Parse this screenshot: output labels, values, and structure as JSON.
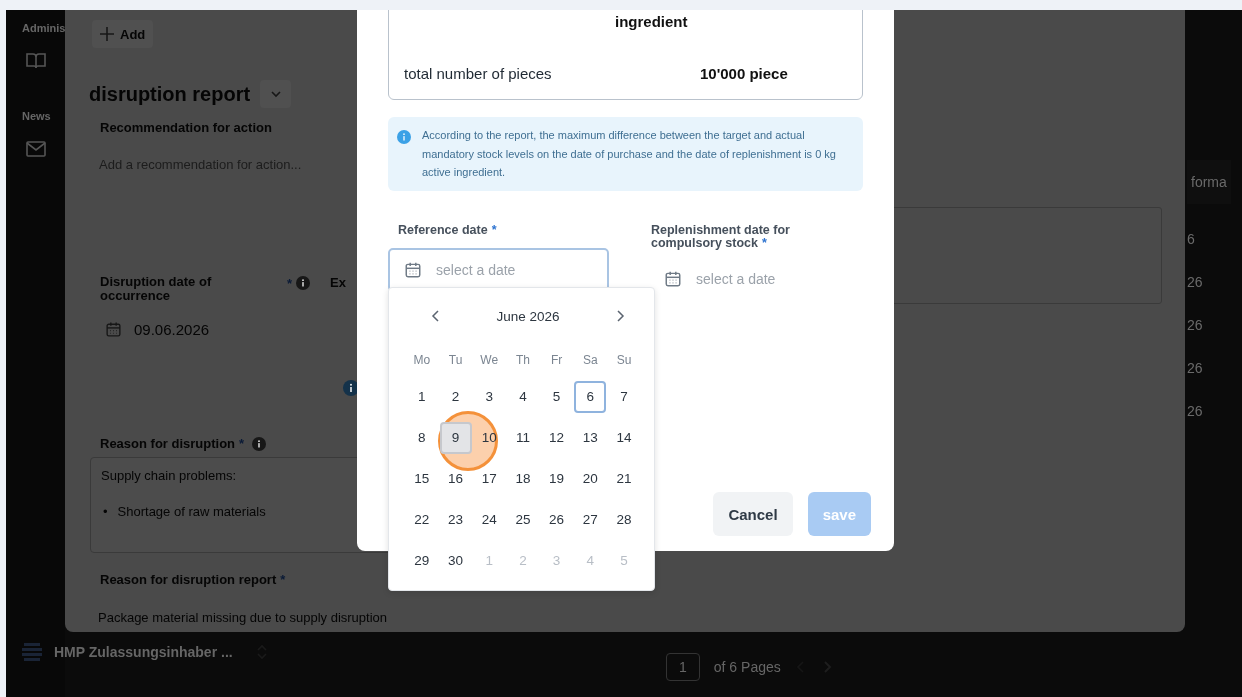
{
  "sidebar": {
    "section_title": "Adminis",
    "news_title": "News"
  },
  "account": {
    "name": "HMP Zulassungsinhaber ..."
  },
  "pager": {
    "page": "1",
    "of_pages": "of 6 Pages"
  },
  "drawer": {
    "add_button": "Add",
    "title": "disruption report",
    "recommendation": {
      "label": "Recommendation for action",
      "placeholder": "Add a recommendation for action..."
    },
    "occurrence": {
      "label": "Disruption date of occurrence",
      "required_mark": "*",
      "value": "09.06.2026"
    },
    "next_column_label": "Ex",
    "reason": {
      "label": "Reason for disruption",
      "required_mark": "*",
      "heading": "Supply chain problems:",
      "bullets": [
        {
          "marker": "•",
          "text": "Shortage of raw materials"
        }
      ]
    },
    "reason_report": {
      "label": "Reason for disruption report",
      "required_mark": "*",
      "value": "Package material missing due to supply disruption"
    },
    "right_peek": [
      "forma",
      "6",
      "26",
      "26",
      "26",
      "26"
    ]
  },
  "modal": {
    "summary": [
      {
        "value": "ingredient"
      },
      {
        "label": "total number of pieces",
        "value": "10'000 piece"
      }
    ],
    "info": "According to the report, the maximum difference between the target and actual mandatory stock levels on the date of purchase and the date of replenishment is 0 kg active ingredient.",
    "fields": [
      {
        "label": "Reference date",
        "required_mark": "*",
        "placeholder": "select a date",
        "focused": true
      },
      {
        "label": "Replenishment date for compulsory stock",
        "required_mark": "*",
        "placeholder": "select a date",
        "focused": false
      }
    ],
    "cancel": {
      "label": "Cancel"
    },
    "save": {
      "label": "save",
      "disabled": true
    }
  },
  "calendar": {
    "month": "June 2026",
    "weekdays": [
      "Mo",
      "Tu",
      "We",
      "Th",
      "Fr",
      "Sa",
      "Su"
    ],
    "days": [
      {
        "label": "1",
        "outside": false,
        "today": false,
        "hovered": false,
        "clicked": false
      },
      {
        "label": "2",
        "outside": false,
        "today": false,
        "hovered": false,
        "clicked": false
      },
      {
        "label": "3",
        "outside": false,
        "today": false,
        "hovered": false,
        "clicked": false
      },
      {
        "label": "4",
        "outside": false,
        "today": false,
        "hovered": false,
        "clicked": false
      },
      {
        "label": "5",
        "outside": false,
        "today": false,
        "hovered": false,
        "clicked": false
      },
      {
        "label": "6",
        "outside": false,
        "today": true,
        "hovered": false,
        "clicked": false
      },
      {
        "label": "7",
        "outside": false,
        "today": false,
        "hovered": false,
        "clicked": false
      },
      {
        "label": "8",
        "outside": false,
        "today": false,
        "hovered": false,
        "clicked": false
      },
      {
        "label": "9",
        "outside": false,
        "today": false,
        "hovered": true,
        "clicked": true
      },
      {
        "label": "10",
        "outside": false,
        "today": false,
        "hovered": false,
        "clicked": false
      },
      {
        "label": "11",
        "outside": false,
        "today": false,
        "hovered": false,
        "clicked": false
      },
      {
        "label": "12",
        "outside": false,
        "today": false,
        "hovered": false,
        "clicked": false
      },
      {
        "label": "13",
        "outside": false,
        "today": false,
        "hovered": false,
        "clicked": false
      },
      {
        "label": "14",
        "outside": false,
        "today": false,
        "hovered": false,
        "clicked": false
      },
      {
        "label": "15",
        "outside": false,
        "today": false,
        "hovered": false,
        "clicked": false
      },
      {
        "label": "16",
        "outside": false,
        "today": false,
        "hovered": false,
        "clicked": false
      },
      {
        "label": "17",
        "outside": false,
        "today": false,
        "hovered": false,
        "clicked": false
      },
      {
        "label": "18",
        "outside": false,
        "today": false,
        "hovered": false,
        "clicked": false
      },
      {
        "label": "19",
        "outside": false,
        "today": false,
        "hovered": false,
        "clicked": false
      },
      {
        "label": "20",
        "outside": false,
        "today": false,
        "hovered": false,
        "clicked": false
      },
      {
        "label": "21",
        "outside": false,
        "today": false,
        "hovered": false,
        "clicked": false
      },
      {
        "label": "22",
        "outside": false,
        "today": false,
        "hovered": false,
        "clicked": false
      },
      {
        "label": "23",
        "outside": false,
        "today": false,
        "hovered": false,
        "clicked": false
      },
      {
        "label": "24",
        "outside": false,
        "today": false,
        "hovered": false,
        "clicked": false
      },
      {
        "label": "25",
        "outside": false,
        "today": false,
        "hovered": false,
        "clicked": false
      },
      {
        "label": "26",
        "outside": false,
        "today": false,
        "hovered": false,
        "clicked": false
      },
      {
        "label": "27",
        "outside": false,
        "today": false,
        "hovered": false,
        "clicked": false
      },
      {
        "label": "28",
        "outside": false,
        "today": false,
        "hovered": false,
        "clicked": false
      },
      {
        "label": "29",
        "outside": false,
        "today": false,
        "hovered": false,
        "clicked": false
      },
      {
        "label": "30",
        "outside": false,
        "today": false,
        "hovered": false,
        "clicked": false
      },
      {
        "label": "1",
        "outside": true,
        "today": false,
        "hovered": false,
        "clicked": false
      },
      {
        "label": "2",
        "outside": true,
        "today": false,
        "hovered": false,
        "clicked": false
      },
      {
        "label": "3",
        "outside": true,
        "today": false,
        "hovered": false,
        "clicked": false
      },
      {
        "label": "4",
        "outside": true,
        "today": false,
        "hovered": false,
        "clicked": false
      },
      {
        "label": "5",
        "outside": true,
        "today": false,
        "hovered": false,
        "clicked": false
      }
    ]
  }
}
